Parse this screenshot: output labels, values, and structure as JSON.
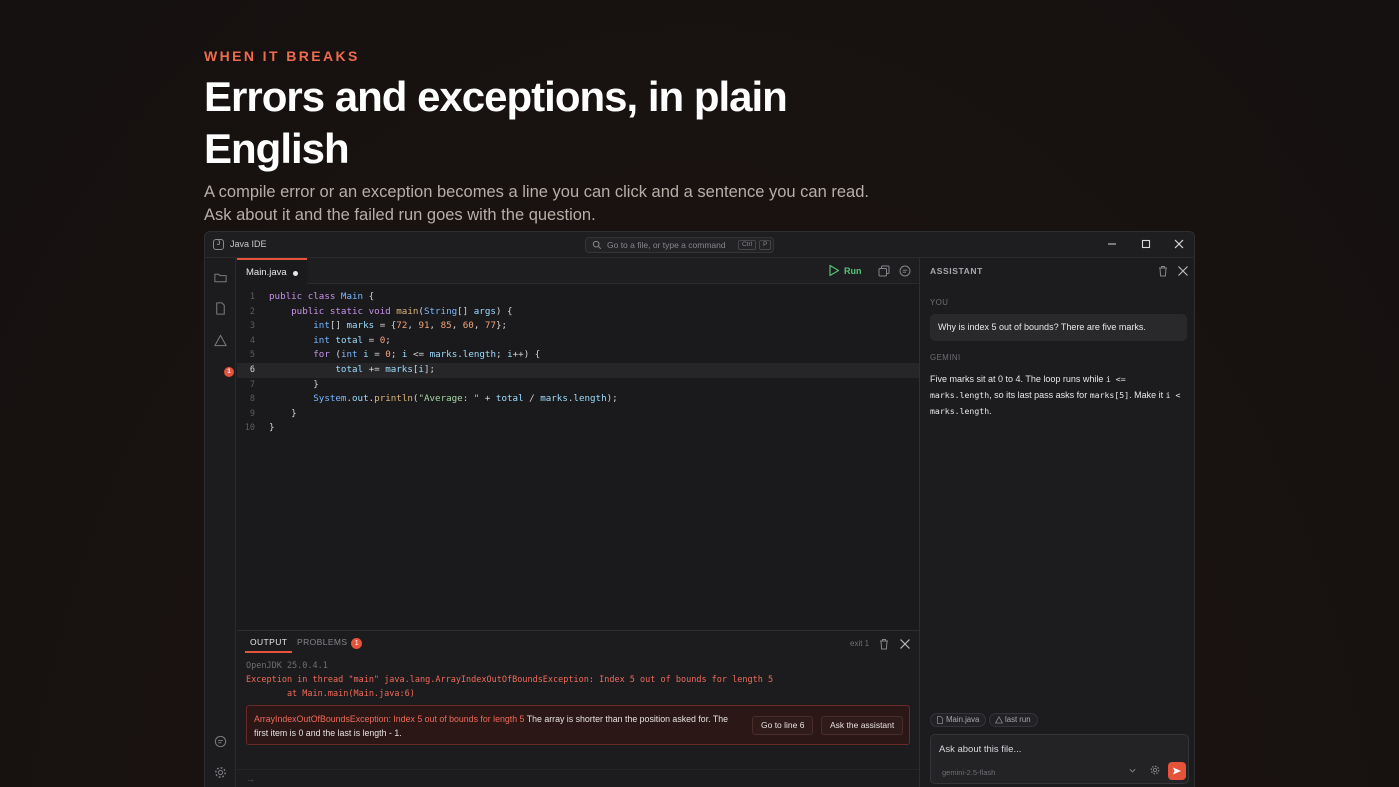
{
  "hero": {
    "eyebrow": "WHEN IT BREAKS",
    "headline": "Errors and exceptions, in plain English",
    "subtext": "A compile error or an exception becomes a line you can click and a sentence you can read. Ask about it and the failed run goes with the question."
  },
  "window": {
    "title": "Java IDE",
    "search_placeholder": "Go to a file, or type a command",
    "shortcut_keys": [
      "Ctrl",
      "P"
    ]
  },
  "sidebar": {
    "problems_count": "1"
  },
  "editor": {
    "tab_name": "Main.java",
    "run_label": "Run",
    "active_line": 6,
    "line_numbers": [
      "1",
      "2",
      "3",
      "4",
      "5",
      "6",
      "7",
      "8",
      "9",
      "10"
    ]
  },
  "panel": {
    "tab_output": "OUTPUT",
    "tab_problems": "PROBLEMS",
    "problems_count": "1",
    "exit_status": "exit 1",
    "jdk_line": "OpenJDK 25.0.4.1",
    "exception_line": "Exception in thread \"main\" java.lang.ArrayIndexOutOfBoundsException: Index 5 out of bounds for length 5",
    "stack_line": "        at Main.main(Main.java:6)",
    "error_card": {
      "exception_name": "ArrayIndexOutOfBoundsException: Index 5 out of bounds for length 5",
      "explanation": " The array is shorter than the position asked for. The first item is 0 and the last is length - 1.",
      "goto_label": "Go to line 6",
      "ask_label": "Ask the assistant"
    },
    "prompt_symbol": "→"
  },
  "assistant": {
    "title": "ASSISTANT",
    "you_label": "YOU",
    "user_message": "Why is index 5 out of bounds? There are five marks.",
    "gemini_label": "GEMINI",
    "reply": {
      "t1": "Five marks sit at 0 to 4. The loop runs while ",
      "c1": "i <= marks.length",
      "t2": ", so its last pass asks for ",
      "c2": "marks[5]",
      "t3": ". Make it ",
      "c3": "i < marks.length",
      "t4": "."
    },
    "chip_file": "Main.java",
    "chip_run": "last run",
    "input_placeholder": "Ask about this file...",
    "model": "gemini-2.5-flash"
  },
  "colors": {
    "accent": "#e5533a",
    "run_green": "#52c47a",
    "error_red": "#f06a5a"
  }
}
